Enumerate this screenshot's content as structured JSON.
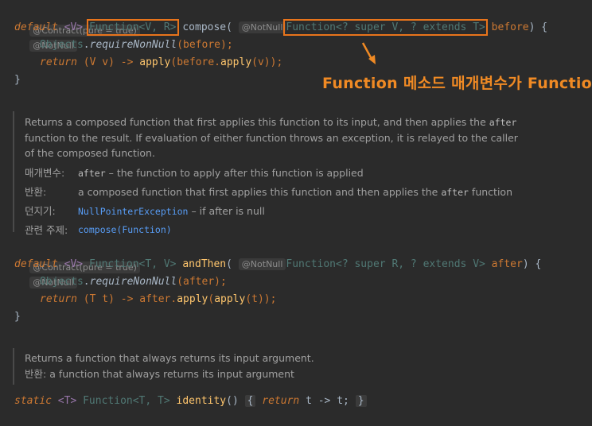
{
  "method1": {
    "contract_hint": "@Contract(pure = true)",
    "notnull_hint": "@NotNull",
    "param_hint": "@NotNull",
    "line1": {
      "modifier": "default",
      "generic": "<V>",
      "return_type": "Function<V, R>",
      "name": "compose",
      "open_paren": "(",
      "param_type": "Function<? super V, ? extends T>",
      "param_name": "before",
      "tail": ") {"
    },
    "line2": {
      "cls": "Objects",
      "dot": ".",
      "method": "requireNonNull",
      "args": "(before);"
    },
    "line3": {
      "kw": "return",
      "lambda": "(V v) -> ",
      "call": "apply",
      "rest": "(before.",
      "call2": "apply",
      "rest2": "(v));"
    },
    "line4": "}"
  },
  "annotation": {
    "text": "Function 메소드 매개변수가 Function"
  },
  "doc1": {
    "summary_1": "Returns a composed function that first applies this function to its input, and then applies the ",
    "summary_after": "after",
    "summary_2": "function to the result. If evaluation of either function throws an exception, it is relayed to the caller",
    "summary_3": "of the composed function.",
    "param_label": "매개변수:",
    "param_name": "after",
    "param_desc": " – the function to apply after this function is applied",
    "returns_label": "반환:",
    "returns_desc_1": "a composed function that first applies this function and then applies the ",
    "returns_after": "after",
    "returns_desc_2": " function",
    "throws_label": "던지기:",
    "throws_exc": "NullPointerException",
    "throws_desc": " – if after is null",
    "see_label": "관련 주제:",
    "see_link": "compose(Function)"
  },
  "method2": {
    "contract_hint": "@Contract(pure = true)",
    "notnull_hint": "@NotNull",
    "param_hint": "@NotNull",
    "line1": {
      "modifier": "default",
      "generic": "<V>",
      "return_type": "Function<T, V>",
      "name": "andThen",
      "open_paren": "(",
      "param_type": "Function<? super R, ? extends V>",
      "param_name": "after",
      "tail": ") {"
    },
    "line2": {
      "cls": "Objects",
      "dot": ".",
      "method": "requireNonNull",
      "args": "(after);"
    },
    "line3": {
      "kw": "return",
      "lambda": "(T t) -> ",
      "obj": "after.",
      "call": "apply",
      "rest": "(",
      "call2": "apply",
      "rest2": "(t));"
    },
    "line4": "}"
  },
  "doc2": {
    "summary": "Returns a function that always returns its input argument.",
    "returns_label": "반환:",
    "returns_desc": "a function that always returns its input argument"
  },
  "method3": {
    "modifier": "static",
    "generic": "<T>",
    "return_type": "Function<T, T>",
    "name": "identity",
    "parens": "()",
    "open_brace": "{",
    "kw": "return",
    "body": "t -> t;",
    "close_brace": "}"
  }
}
